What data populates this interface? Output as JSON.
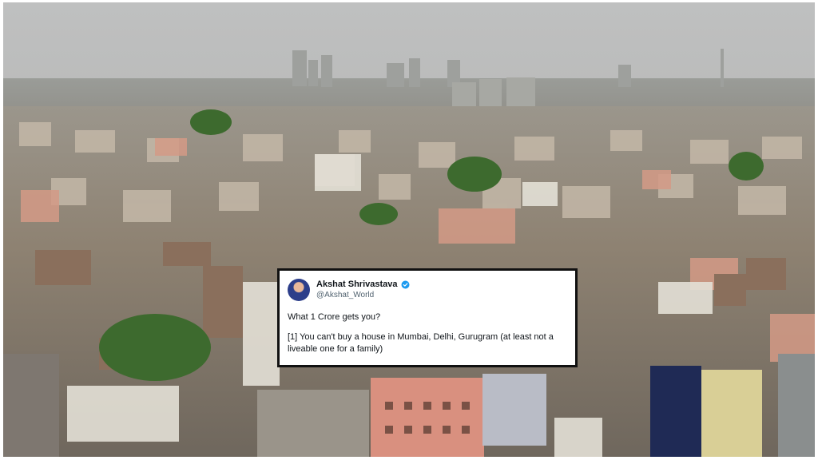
{
  "photo": {
    "subject": "city-skyline-photo"
  },
  "tweet": {
    "author_name": "Akshat Shrivastava",
    "author_handle": "@Akshat_World",
    "verified": true,
    "lines": [
      "What 1 Crore gets you?",
      "[1] You can't buy a house in Mumbai, Delhi, Gurugram (at least not a liveable one for a family)"
    ],
    "icons": {
      "avatar": "avatar",
      "verified": "verified-badge-icon"
    },
    "colors": {
      "verified": "#1d9bf0",
      "handle": "#536471",
      "border": "#111111"
    }
  }
}
